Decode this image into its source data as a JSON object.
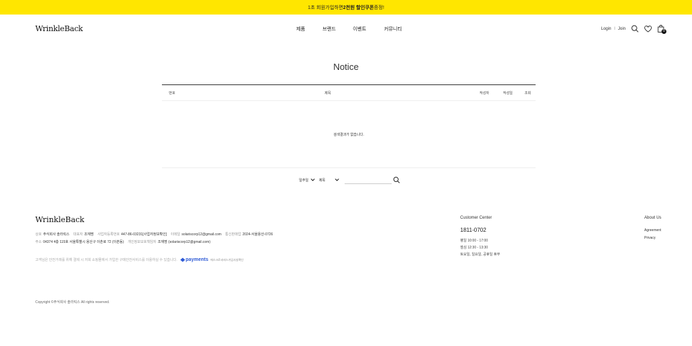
{
  "topbar": {
    "prefix": "1초 회원가입하면 ",
    "highlight": "2천원 할인쿠폰",
    "suffix": " 증정!"
  },
  "header": {
    "logo": "WrinkleBack",
    "nav": [
      "제품",
      "브랜드",
      "이벤트",
      "커뮤니티"
    ],
    "login": "Login",
    "separator": "I",
    "join": "Join",
    "cart_count": "0"
  },
  "board": {
    "title": "Notice",
    "columns": {
      "number": "번호",
      "subject": "제목",
      "author": "작성자",
      "date": "작성일",
      "views": "조회"
    },
    "empty_message": "검색결과가 없습니다."
  },
  "search": {
    "period": "일주일",
    "field": "제목",
    "query": ""
  },
  "footer": {
    "logo": "WrinkleBack",
    "row1": [
      {
        "k": "상호",
        "v": "주식회사 솔라릭스"
      },
      {
        "k": "대표자",
        "v": "조재명"
      },
      {
        "k": "사업자등록번호",
        "v": "447-86-03231[사업자정보확인]"
      },
      {
        "k": "이메일",
        "v": "solariscorp12@gmail.com"
      },
      {
        "k": "통신판매업",
        "v": "2024-서울용산-0726"
      }
    ],
    "row2": [
      {
        "k": "주소",
        "v": "04374 4층 115호 서울특별시 용산구 이촌로 72 (이촌동)"
      },
      {
        "k": "개인정보보호책임자",
        "v": "조재명 (solariscorp12@gmail.com)"
      }
    ],
    "safety_note": "고객님은 안전거래를 위해 결제 시 저희 쇼핑몰에서 가입한 구매안전서비스를 이용하실 수 있습니다.",
    "pay_logo": "payments",
    "pay_sub": "에스크로서비스가입사실확인",
    "cs": {
      "title": "Customer Center",
      "phone": "1811-0702",
      "hours": "평일 10:00 - 17:00",
      "lunch": "점심 12:30 - 13:30",
      "closed": "토요일, 일요일, 공휴일 휴무"
    },
    "about": {
      "title": "About Us",
      "links": [
        "Agreement",
        "Privacy"
      ]
    },
    "copyright": "Copyright ©주식회사 솔라릭스 All rights reserved."
  }
}
